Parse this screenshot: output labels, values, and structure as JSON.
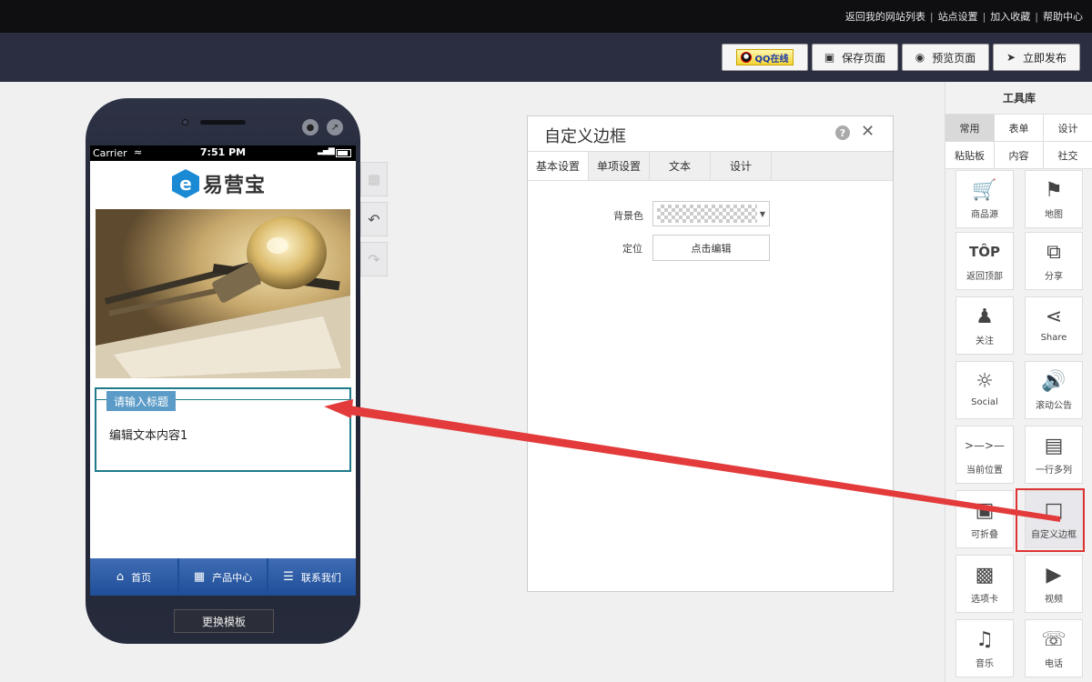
{
  "topbar": {
    "links": [
      "返回我的网站列表",
      "站点设置",
      "加入收藏",
      "帮助中心"
    ]
  },
  "actions": {
    "qq_label": "QQ在线",
    "save_label": "保存页面",
    "preview_label": "预览页面",
    "publish_label": "立即发布"
  },
  "phone": {
    "carrier": "Carrier",
    "time": "7:51 PM",
    "logo_text": "易营宝",
    "logo_mark": "e",
    "widget_title": "请输入标题",
    "widget_body": "编辑文本内容1",
    "nav": [
      {
        "label": "首页",
        "icon": "home-icon"
      },
      {
        "label": "产品中心",
        "icon": "gallery-icon"
      },
      {
        "label": "联系我们",
        "icon": "list-icon"
      }
    ],
    "change_template": "更换模板"
  },
  "dialog": {
    "title": "自定义边框",
    "help": "?",
    "tabs": [
      {
        "label": "基本设置",
        "active": true
      },
      {
        "label": "单项设置",
        "active": false
      },
      {
        "label": "文本",
        "active": false
      },
      {
        "label": "设计",
        "active": false
      }
    ],
    "bg_label": "背景色",
    "pos_label": "定位",
    "edit_button": "点击编辑"
  },
  "toollib": {
    "title": "工具库",
    "tabs": [
      {
        "label": "常用",
        "active": true
      },
      {
        "label": "表单",
        "active": false
      },
      {
        "label": "设计",
        "active": false
      },
      {
        "label": "粘贴板",
        "active": false
      },
      {
        "label": "内容",
        "active": false
      },
      {
        "label": "社交",
        "active": false
      }
    ],
    "items": [
      {
        "label": "商品源",
        "icon": "cart-icon"
      },
      {
        "label": "地图",
        "icon": "map-icon"
      },
      {
        "label": "返回顶部",
        "icon": "top-icon"
      },
      {
        "label": "分享",
        "icon": "share-box-icon"
      },
      {
        "label": "关注",
        "icon": "user-plus-icon"
      },
      {
        "label": "Share",
        "icon": "share-icon"
      },
      {
        "label": "Social",
        "icon": "rss-icon"
      },
      {
        "label": "滚动公告",
        "icon": "speaker-icon"
      },
      {
        "label": "当前位置",
        "icon": "breadcrumb-icon"
      },
      {
        "label": "一行多列",
        "icon": "columns-icon"
      },
      {
        "label": "可折叠",
        "icon": "collapse-icon"
      },
      {
        "label": "自定义边框",
        "icon": "border-frame-icon"
      },
      {
        "label": "选项卡",
        "icon": "tabs-icon"
      },
      {
        "label": "视频",
        "icon": "video-icon"
      },
      {
        "label": "音乐",
        "icon": "music-icon"
      },
      {
        "label": "电话",
        "icon": "phone-icon"
      }
    ],
    "selected_item": "自定义边框"
  },
  "colors": {
    "annotation": "#e33b3b",
    "widget_border": "#1e7a8a",
    "nav_blue": "#1f4f99"
  }
}
